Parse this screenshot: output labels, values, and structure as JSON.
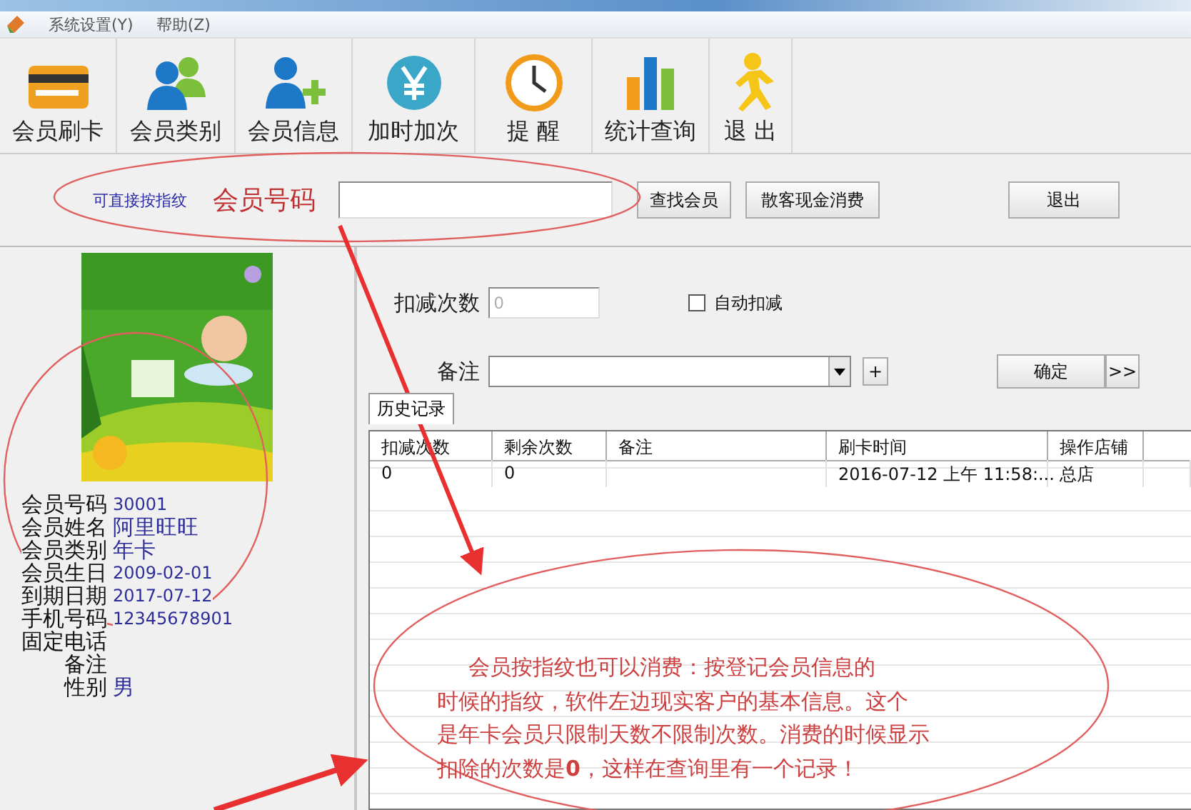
{
  "menu": [
    {
      "label": "系统设置(Y)"
    },
    {
      "label": "帮助(Z)"
    }
  ],
  "toolbar": [
    {
      "label": "会员刷卡",
      "kind": "card"
    },
    {
      "label": "会员类别",
      "kind": "group"
    },
    {
      "label": "会员信息",
      "kind": "adduser"
    },
    {
      "label": "加时加次",
      "kind": "yen"
    },
    {
      "label": "提 醒",
      "kind": "clock"
    },
    {
      "label": "统计查询",
      "kind": "chart"
    },
    {
      "label": "退 出",
      "kind": "run"
    }
  ],
  "search": {
    "hint": "可直接按指纹",
    "label": "会员号码",
    "buttons": [
      "查找会员",
      "散客现金消费"
    ],
    "exit": "退出"
  },
  "member": {
    "fields": [
      {
        "label": "会员号码",
        "value": "30001"
      },
      {
        "label": "会员姓名",
        "value": "阿里旺旺"
      },
      {
        "label": "会员类别",
        "value": "年卡"
      },
      {
        "label": "会员生日",
        "value": "2009-02-01"
      },
      {
        "label": "到期日期",
        "value": "2017-07-12"
      },
      {
        "label": "手机号码",
        "value": "12345678901"
      },
      {
        "label": "固定电话"
      },
      {
        "label": "备注"
      },
      {
        "label": "性别",
        "value": "男"
      }
    ]
  },
  "deduct": {
    "label": "扣减次数",
    "value": "0",
    "disabled": true,
    "auto": {
      "label": "自动扣减",
      "checked": false
    }
  },
  "remark": {
    "label": "备注",
    "add": "+",
    "ok": "确定",
    "more": ">>"
  },
  "tabs": [
    {
      "label": "历史记录",
      "selected": true
    }
  ],
  "table": {
    "columns": [
      "扣减次数",
      "剩余次数",
      "备注",
      "刷卡时间",
      "操作店铺"
    ],
    "rows": [
      {
        "deduct": "0",
        "remaining": "0",
        "time": "2016-07-12 上午 11:58:...",
        "shop": "总店"
      }
    ]
  },
  "annotation": {
    "lines": [
      "会员按指纹也可以消费：按登记会员信息的",
      "时候的指纹，软件左边现实客户的基本信息。这个",
      "是年卡会员只限制天数不限制次数。消费的时候显示",
      "扣除的次数是**0**，这样在查询里有一个记录！"
    ]
  }
}
